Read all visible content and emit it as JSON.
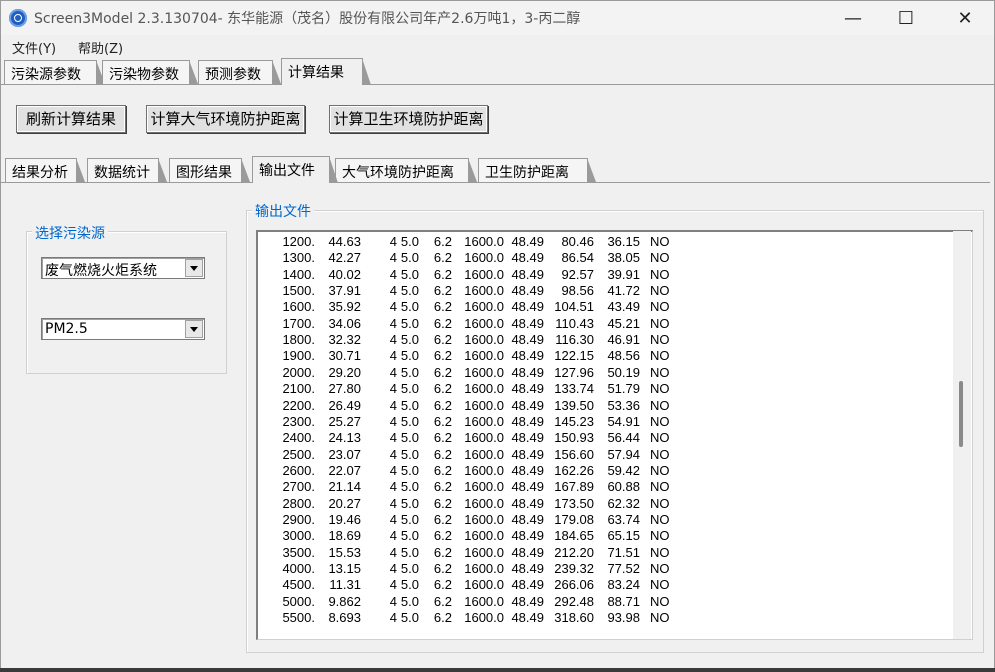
{
  "window": {
    "title": "Screen3Model 2.3.130704- 东华能源（茂名）股份有限公司年产2.6万吨1，3-丙二醇",
    "controls": {
      "minimize": "—",
      "maximize": "☐",
      "close": "✕"
    }
  },
  "menu": {
    "file": "文件(Y)",
    "help": "帮助(Z)"
  },
  "main_tabs": [
    "污染源参数",
    "污染物参数",
    "预测参数",
    "计算结果"
  ],
  "toolbar": {
    "refresh_label": "刷新计算结果",
    "calc_atmos_label": "计算大气环境防护距离",
    "calc_health_label": "计算卫生环境防护距离"
  },
  "sub_tabs": [
    "结果分析",
    "数据统计",
    "图形结果",
    "输出文件",
    "大气环境防护距离",
    "卫生防护距离"
  ],
  "source_panel": {
    "legend": "选择污染源",
    "source_value": "废气燃烧火炬系统",
    "pollutant_value": "PM2.5"
  },
  "output_panel": {
    "legend": "输出文件",
    "rows": [
      [
        "1200.",
        "44.63",
        "4",
        "5.0",
        "6.2",
        "1600.0",
        "48.49",
        "80.46",
        "36.15",
        "NO"
      ],
      [
        "1300.",
        "42.27",
        "4",
        "5.0",
        "6.2",
        "1600.0",
        "48.49",
        "86.54",
        "38.05",
        "NO"
      ],
      [
        "1400.",
        "40.02",
        "4",
        "5.0",
        "6.2",
        "1600.0",
        "48.49",
        "92.57",
        "39.91",
        "NO"
      ],
      [
        "1500.",
        "37.91",
        "4",
        "5.0",
        "6.2",
        "1600.0",
        "48.49",
        "98.56",
        "41.72",
        "NO"
      ],
      [
        "1600.",
        "35.92",
        "4",
        "5.0",
        "6.2",
        "1600.0",
        "48.49",
        "104.51",
        "43.49",
        "NO"
      ],
      [
        "1700.",
        "34.06",
        "4",
        "5.0",
        "6.2",
        "1600.0",
        "48.49",
        "110.43",
        "45.21",
        "NO"
      ],
      [
        "1800.",
        "32.32",
        "4",
        "5.0",
        "6.2",
        "1600.0",
        "48.49",
        "116.30",
        "46.91",
        "NO"
      ],
      [
        "1900.",
        "30.71",
        "4",
        "5.0",
        "6.2",
        "1600.0",
        "48.49",
        "122.15",
        "48.56",
        "NO"
      ],
      [
        "2000.",
        "29.20",
        "4",
        "5.0",
        "6.2",
        "1600.0",
        "48.49",
        "127.96",
        "50.19",
        "NO"
      ],
      [
        "2100.",
        "27.80",
        "4",
        "5.0",
        "6.2",
        "1600.0",
        "48.49",
        "133.74",
        "51.79",
        "NO"
      ],
      [
        "2200.",
        "26.49",
        "4",
        "5.0",
        "6.2",
        "1600.0",
        "48.49",
        "139.50",
        "53.36",
        "NO"
      ],
      [
        "2300.",
        "25.27",
        "4",
        "5.0",
        "6.2",
        "1600.0",
        "48.49",
        "145.23",
        "54.91",
        "NO"
      ],
      [
        "2400.",
        "24.13",
        "4",
        "5.0",
        "6.2",
        "1600.0",
        "48.49",
        "150.93",
        "56.44",
        "NO"
      ],
      [
        "2500.",
        "23.07",
        "4",
        "5.0",
        "6.2",
        "1600.0",
        "48.49",
        "156.60",
        "57.94",
        "NO"
      ],
      [
        "2600.",
        "22.07",
        "4",
        "5.0",
        "6.2",
        "1600.0",
        "48.49",
        "162.26",
        "59.42",
        "NO"
      ],
      [
        "2700.",
        "21.14",
        "4",
        "5.0",
        "6.2",
        "1600.0",
        "48.49",
        "167.89",
        "60.88",
        "NO"
      ],
      [
        "2800.",
        "20.27",
        "4",
        "5.0",
        "6.2",
        "1600.0",
        "48.49",
        "173.50",
        "62.32",
        "NO"
      ],
      [
        "2900.",
        "19.46",
        "4",
        "5.0",
        "6.2",
        "1600.0",
        "48.49",
        "179.08",
        "63.74",
        "NO"
      ],
      [
        "3000.",
        "18.69",
        "4",
        "5.0",
        "6.2",
        "1600.0",
        "48.49",
        "184.65",
        "65.15",
        "NO"
      ],
      [
        "3500.",
        "15.53",
        "4",
        "5.0",
        "6.2",
        "1600.0",
        "48.49",
        "212.20",
        "71.51",
        "NO"
      ],
      [
        "4000.",
        "13.15",
        "4",
        "5.0",
        "6.2",
        "1600.0",
        "48.49",
        "239.32",
        "77.52",
        "NO"
      ],
      [
        "4500.",
        "11.31",
        "4",
        "5.0",
        "6.2",
        "1600.0",
        "48.49",
        "266.06",
        "83.24",
        "NO"
      ],
      [
        "5000.",
        "9.862",
        "4",
        "5.0",
        "6.2",
        "1600.0",
        "48.49",
        "292.48",
        "88.71",
        "NO"
      ],
      [
        "5500.",
        "8.693",
        "4",
        "5.0",
        "6.2",
        "1600.0",
        "48.49",
        "318.60",
        "93.98",
        "NO"
      ]
    ]
  }
}
